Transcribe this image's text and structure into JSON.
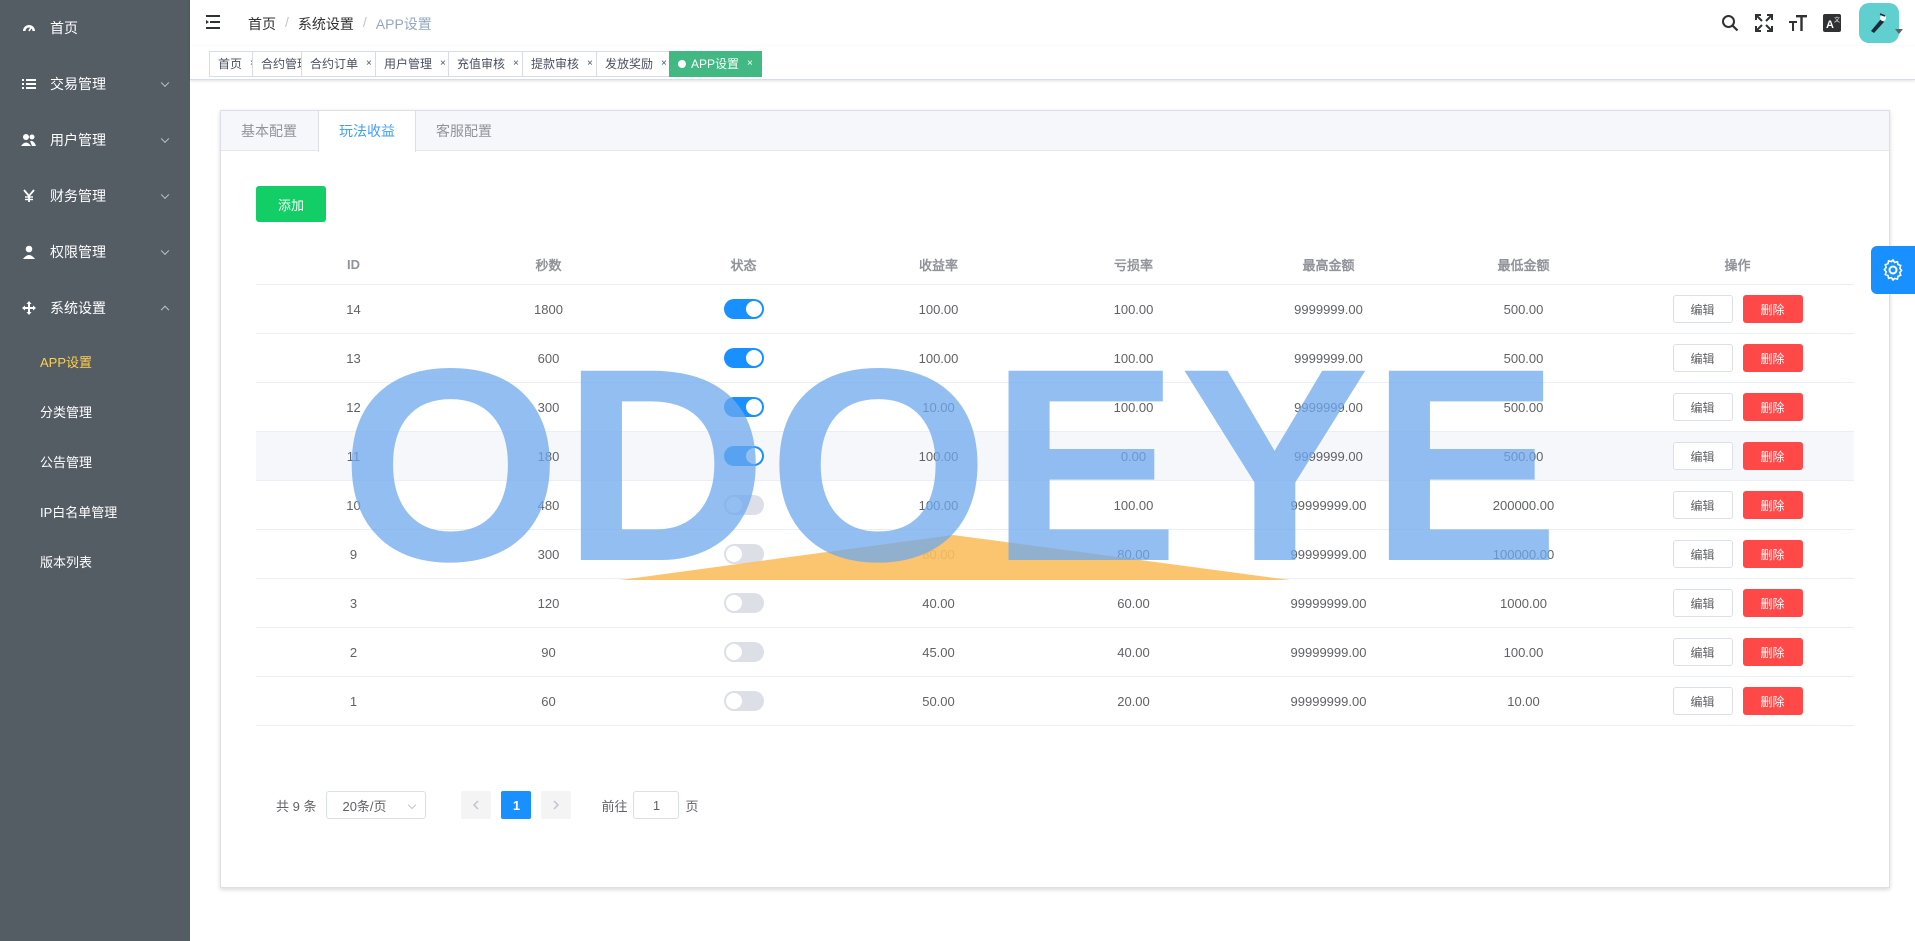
{
  "sidebar": {
    "items": [
      {
        "label": "首页",
        "icon": "dashboard-icon",
        "arrow": null
      },
      {
        "label": "交易管理",
        "icon": "list-icon",
        "arrow": "down"
      },
      {
        "label": "用户管理",
        "icon": "users-icon",
        "arrow": "down"
      },
      {
        "label": "财务管理",
        "icon": "yen-icon",
        "arrow": "down"
      },
      {
        "label": "权限管理",
        "icon": "user-icon",
        "arrow": "down"
      },
      {
        "label": "系统设置",
        "icon": "move-icon",
        "arrow": "up"
      }
    ],
    "sub_items": [
      {
        "label": "APP设置",
        "active": true
      },
      {
        "label": "分类管理",
        "active": false
      },
      {
        "label": "公告管理",
        "active": false
      },
      {
        "label": "IP白名单管理",
        "active": false
      },
      {
        "label": "版本列表",
        "active": false
      }
    ]
  },
  "breadcrumb": [
    "首页",
    "系统设置",
    "APP设置"
  ],
  "tags": [
    {
      "label": "首页",
      "active": false
    },
    {
      "label": "合约管理",
      "active": false
    },
    {
      "label": "合约订单",
      "active": false
    },
    {
      "label": "用户管理",
      "active": false
    },
    {
      "label": "充值审核",
      "active": false
    },
    {
      "label": "提款审核",
      "active": false
    },
    {
      "label": "发放奖励",
      "active": false
    },
    {
      "label": "APP设置",
      "active": true
    }
  ],
  "tags_close": "×",
  "tabs": [
    "基本配置",
    "玩法收益",
    "客服配置"
  ],
  "active_tab": 1,
  "add_button": "添加",
  "table": {
    "headers": [
      "ID",
      "秒数",
      "状态",
      "收益率",
      "亏损率",
      "最高金额",
      "最低金额",
      "操作"
    ],
    "rows": [
      {
        "id": "14",
        "seconds": "1800",
        "status": true,
        "rate": "100.00",
        "loss": "100.00",
        "max": "9999999.00",
        "min": "500.00"
      },
      {
        "id": "13",
        "seconds": "600",
        "status": true,
        "rate": "100.00",
        "loss": "100.00",
        "max": "9999999.00",
        "min": "500.00"
      },
      {
        "id": "12",
        "seconds": "300",
        "status": true,
        "rate": "10.00",
        "loss": "100.00",
        "max": "9999999.00",
        "min": "500.00"
      },
      {
        "id": "11",
        "seconds": "180",
        "status": true,
        "rate": "100.00",
        "loss": "0.00",
        "max": "9999999.00",
        "min": "500.00"
      },
      {
        "id": "10",
        "seconds": "480",
        "status": false,
        "rate": "100.00",
        "loss": "100.00",
        "max": "99999999.00",
        "min": "200000.00"
      },
      {
        "id": "9",
        "seconds": "300",
        "status": false,
        "rate": "80.00",
        "loss": "80.00",
        "max": "99999999.00",
        "min": "100000.00"
      },
      {
        "id": "3",
        "seconds": "120",
        "status": false,
        "rate": "40.00",
        "loss": "60.00",
        "max": "99999999.00",
        "min": "1000.00"
      },
      {
        "id": "2",
        "seconds": "90",
        "status": false,
        "rate": "45.00",
        "loss": "40.00",
        "max": "99999999.00",
        "min": "100.00"
      },
      {
        "id": "1",
        "seconds": "60",
        "status": false,
        "rate": "50.00",
        "loss": "20.00",
        "max": "99999999.00",
        "min": "10.00"
      }
    ],
    "edit_label": "编辑",
    "delete_label": "删除"
  },
  "pagination": {
    "total": "共 9 条",
    "page_size": "20条/页",
    "current": "1",
    "goto_prefix": "前往",
    "goto_value": "1",
    "goto_suffix": "页"
  },
  "watermark": "ODOEYE",
  "colors": {
    "sidebar_bg": "#545c64",
    "sidebar_active": "#ffd04b",
    "primary": "#1890ff",
    "success": "#13ce66",
    "danger": "#ff4949",
    "tag_active": "#42b983",
    "watermark_blue": "#6ea8ed",
    "watermark_orange": "#fbbf60"
  }
}
